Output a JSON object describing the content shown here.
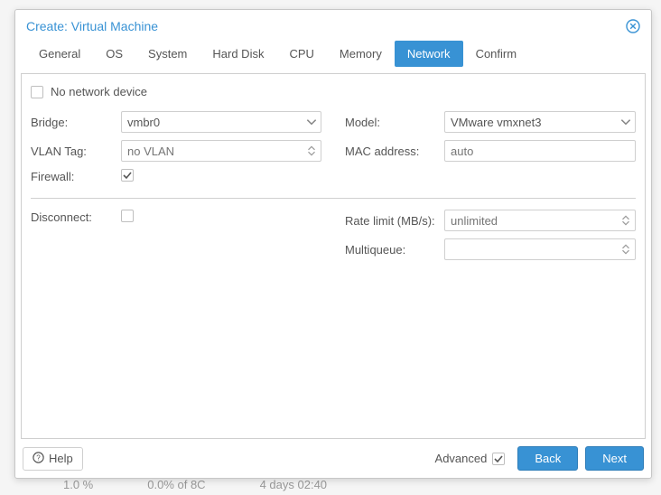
{
  "dialog": {
    "title": "Create: Virtual Machine"
  },
  "tabs": {
    "general": "General",
    "os": "OS",
    "system": "System",
    "harddisk": "Hard Disk",
    "cpu": "CPU",
    "memory": "Memory",
    "network": "Network",
    "confirm": "Confirm"
  },
  "network": {
    "no_device_label": "No network device",
    "no_device_checked": false,
    "bridge_label": "Bridge:",
    "bridge_value": "vmbr0",
    "vlan_label": "VLAN Tag:",
    "vlan_placeholder": "no VLAN",
    "firewall_label": "Firewall:",
    "firewall_checked": true,
    "model_label": "Model:",
    "model_value": "VMware vmxnet3",
    "mac_label": "MAC address:",
    "mac_placeholder": "auto",
    "disconnect_label": "Disconnect:",
    "disconnect_checked": false,
    "rate_label": "Rate limit (MB/s):",
    "rate_placeholder": "unlimited",
    "multiqueue_label": "Multiqueue:",
    "multiqueue_value": ""
  },
  "footer": {
    "help": "Help",
    "advanced_label": "Advanced",
    "advanced_checked": true,
    "back": "Back",
    "next": "Next"
  },
  "background": {
    "a": "1.0 %",
    "b": "0.0% of 8C",
    "c": "4 days 02:40"
  }
}
